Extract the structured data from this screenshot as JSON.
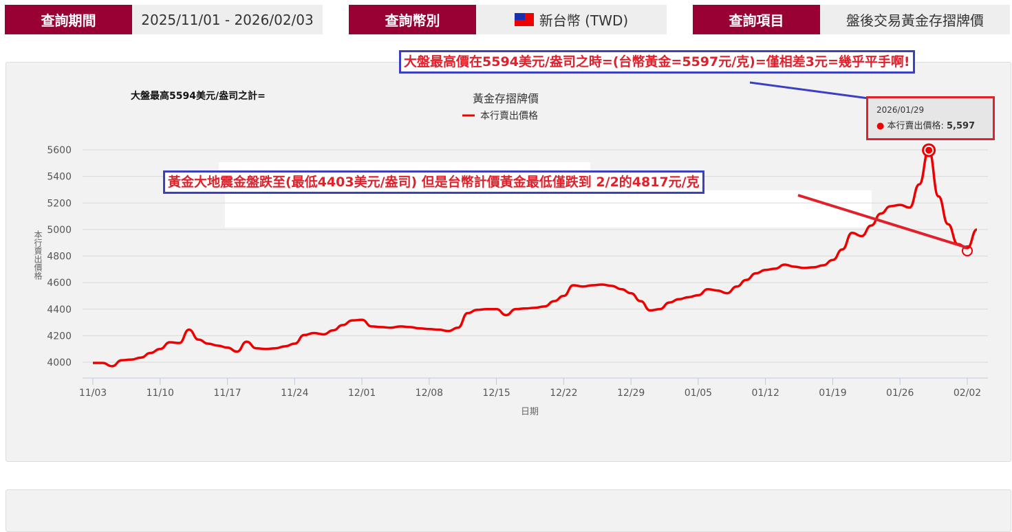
{
  "header": {
    "period_label": "查詢期間",
    "period_value": "2025/11/01 - 2026/02/03",
    "currency_label": "查詢幣別",
    "currency_value": "新台幣 (TWD)",
    "item_label": "查詢項目",
    "item_value": "盤後交易黃金存摺牌價"
  },
  "annotations": {
    "top_note": "大盤最高價在5594美元/盎司之時=(台幣黃金=5597元/克)=僅相差3元=幾乎平手啊!",
    "left_note": "大盤最高5594美元/盎司之計=",
    "mid_note": "黃金大地震金盤跌至(最低4403美元/盎司) 但是台幣計價黃金最低僅跌到 2/2的4817元/克"
  },
  "tooltip": {
    "date": "2026/01/29",
    "series": "本行賣出價格:",
    "value": "5,597"
  },
  "colors": {
    "brand": "#990033",
    "line": "#e00000",
    "note_border": "#3b3fc4"
  },
  "chart_data": {
    "type": "line",
    "title": "黃金存摺牌價",
    "legend": [
      "本行賣出價格"
    ],
    "legend_position": "top-center",
    "xlabel": "日期",
    "ylabel": "本行賣出價格",
    "ylim": [
      3900,
      5650
    ],
    "yticks": [
      4000,
      4200,
      4400,
      4600,
      4800,
      5000,
      5200,
      5400,
      5600
    ],
    "xticks": [
      "11/03",
      "11/10",
      "11/17",
      "11/24",
      "12/01",
      "12/08",
      "12/15",
      "12/22",
      "12/29",
      "01/05",
      "01/12",
      "01/19",
      "01/26",
      "02/02"
    ],
    "x_start": "2025/11/03",
    "x_step_days": 1,
    "values": [
      3995,
      3995,
      3970,
      4015,
      4020,
      4035,
      4070,
      4100,
      4150,
      4145,
      4245,
      4170,
      4140,
      4125,
      4110,
      4080,
      4155,
      4105,
      4100,
      4105,
      4120,
      4140,
      4205,
      4220,
      4210,
      4240,
      4280,
      4315,
      4320,
      4270,
      4265,
      4260,
      4270,
      4265,
      4255,
      4250,
      4245,
      4235,
      4260,
      4370,
      4395,
      4400,
      4400,
      4355,
      4400,
      4405,
      4410,
      4420,
      4460,
      4500,
      4580,
      4570,
      4580,
      4585,
      4575,
      4550,
      4520,
      4460,
      4390,
      4400,
      4450,
      4475,
      4490,
      4505,
      4550,
      4540,
      4520,
      4570,
      4620,
      4670,
      4695,
      4705,
      4735,
      4720,
      4710,
      4715,
      4730,
      4770,
      4850,
      4975,
      4950,
      5030,
      5120,
      5175,
      5185,
      5165,
      5340,
      5597,
      5250,
      5040,
      4890,
      4860,
      5000
    ],
    "highlight": [
      {
        "index": 87,
        "value": 5597
      },
      {
        "index": 91,
        "value": 4860
      }
    ]
  }
}
